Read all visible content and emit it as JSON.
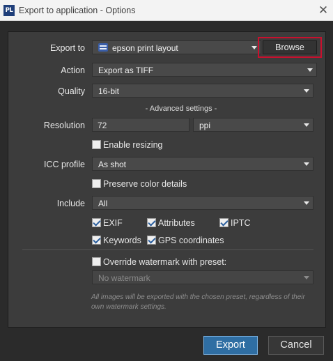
{
  "window": {
    "logo_text": "PL",
    "title": "Export to application - Options",
    "close_glyph": "✕"
  },
  "export_to": {
    "label": "Export to",
    "value": "epson print layout",
    "icon": "epson-printer-icon",
    "browse_label": "Browse"
  },
  "action": {
    "label": "Action",
    "value": "Export as TIFF"
  },
  "quality": {
    "label": "Quality",
    "value": "16-bit"
  },
  "advanced_title": "- Advanced settings -",
  "resolution": {
    "label": "Resolution",
    "value": "72",
    "unit": "ppi"
  },
  "enable_resizing": {
    "label": "Enable resizing",
    "checked": false
  },
  "icc_profile": {
    "label": "ICC profile",
    "value": "As shot"
  },
  "preserve_color": {
    "label": "Preserve color details",
    "checked": false
  },
  "include": {
    "label": "Include",
    "value": "All",
    "options": [
      {
        "label": "EXIF",
        "checked": true
      },
      {
        "label": "Attributes",
        "checked": true
      },
      {
        "label": "IPTC",
        "checked": true
      },
      {
        "label": "Keywords",
        "checked": true
      },
      {
        "label": "GPS coordinates",
        "checked": true
      }
    ]
  },
  "watermark": {
    "override_label": "Override watermark with preset:",
    "checked": false,
    "preset_value": "No watermark",
    "note": "All images will be exported with the chosen preset, regardless of their own watermark settings."
  },
  "buttons": {
    "export": "Export",
    "cancel": "Cancel"
  },
  "colors": {
    "highlight_border": "#c8102e",
    "primary_button": "#2f6ea3",
    "panel_bg": "#3c3c3c",
    "window_bg": "#2b2b2b"
  }
}
